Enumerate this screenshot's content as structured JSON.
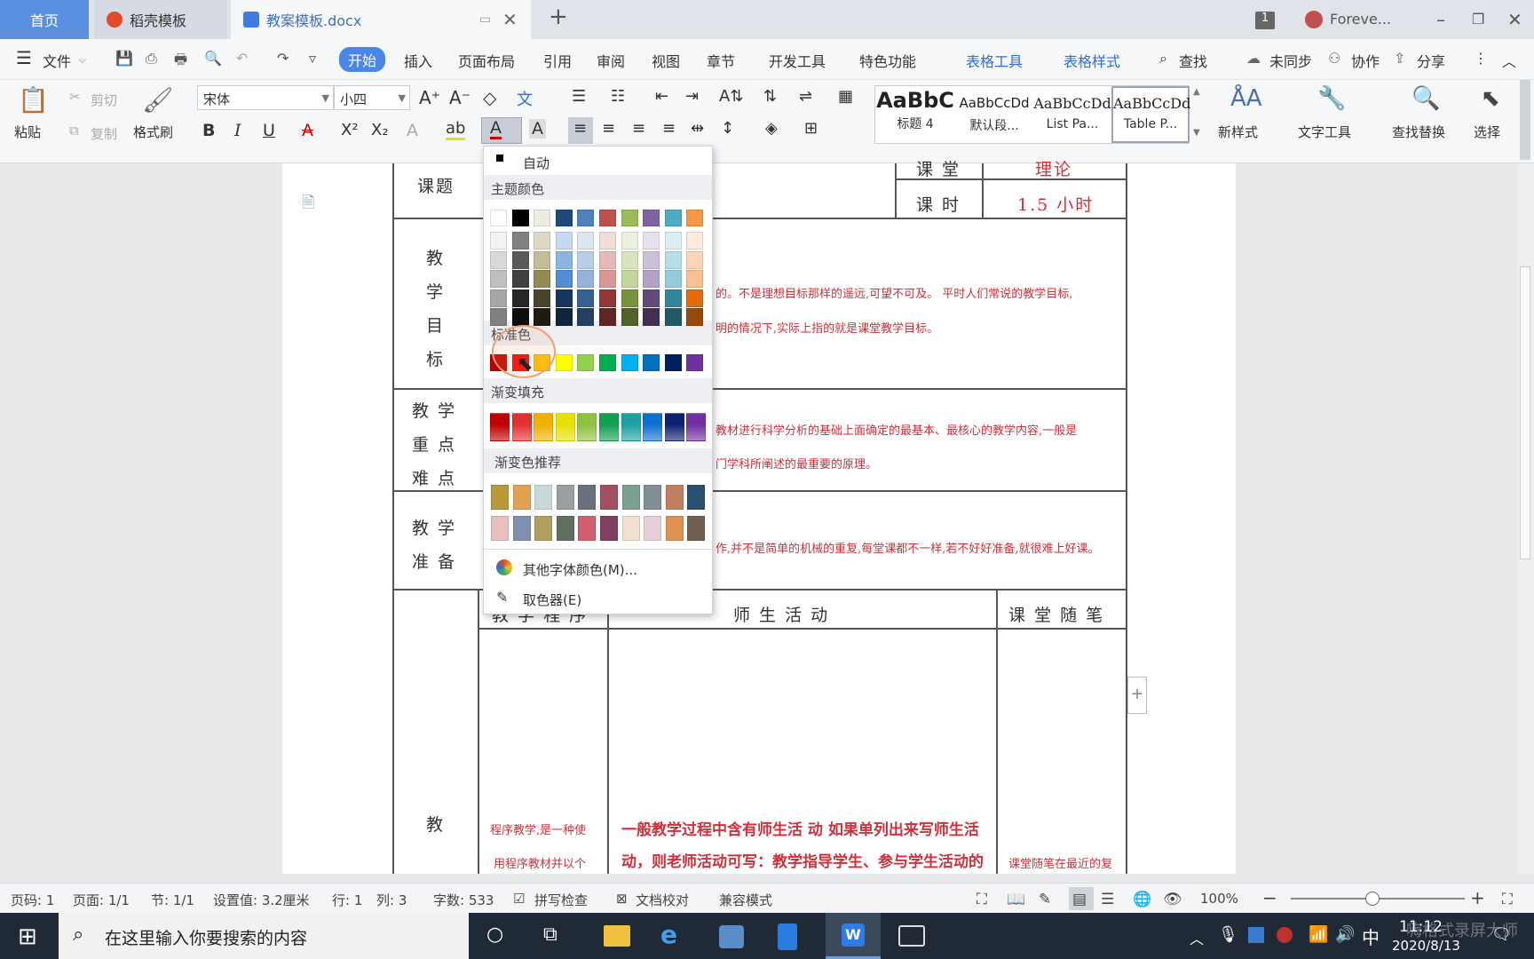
{
  "tabs": {
    "home": "首页",
    "template": "稻壳模板",
    "doc": "教案模板.docx",
    "user": "Foreve...",
    "page_badge": "1"
  },
  "menu": {
    "file": "文件",
    "items": [
      "开始",
      "插入",
      "页面布局",
      "引用",
      "审阅",
      "视图",
      "章节",
      "开发工具",
      "特色功能"
    ],
    "table_tools": "表格工具",
    "table_style": "表格样式",
    "find": "查找",
    "unsync": "未同步",
    "collab": "协作",
    "share": "分享"
  },
  "ribbon": {
    "paste": "粘贴",
    "cut": "剪切",
    "copy": "复制",
    "format_painter": "格式刷",
    "font": "宋体",
    "size": "小四",
    "styles": [
      {
        "big": "AaBbC",
        "name": "标题 4"
      },
      {
        "big": "AaBbCcDd",
        "name": "默认段..."
      },
      {
        "big": "AaBbCcDd",
        "name": "List Pa..."
      },
      {
        "big": "AaBbCcDd",
        "name": "Table P..."
      }
    ],
    "new_style": "新样式",
    "text_tools": "文字工具",
    "find_replace": "查找替换",
    "select": "选择"
  },
  "doc": {
    "ketizhu": "课题",
    "ketang": "课 堂",
    "lilun": "理论",
    "keshi": "课 时",
    "keshi_val": "1.5 小时",
    "c1": [
      "教",
      "学",
      "目",
      "标"
    ],
    "c2": [
      "教 学",
      "重 点",
      "难 点"
    ],
    "c3": [
      "教 学",
      "准 备"
    ],
    "c4": "教",
    "jiaoxue_chengxu": "教 学 程 序",
    "shisheng": "师 生 活 动",
    "suibi": "课 堂 随 笔",
    "red1": "的。不是理想目标那样的遥远,可望不可及。 平时人们常说的教学目标,",
    "red2": "明的情况下,实际上指的就是课堂教学目标。",
    "red3": "教材进行科学分析的基础上面确定的最基本、最核心的教学内容,一般是",
    "red4": "门学科所阐述的最重要的原理。",
    "red5": "作,并不是简单的机械的重复,每堂课都不一样,若不好好准备,就很难上好课。",
    "red6": "程序教学,是一种使",
    "red7": "用程序教材并以个",
    "red8": "一般教学过程中含有师生活 动 如果单列出来写师生活",
    "red9": "动，则老师活动可写：教学指导学生、参与学生活动的",
    "red10": "课堂随笔在最近的复"
  },
  "dropdown": {
    "auto": "自动",
    "theme": "主题颜色",
    "standard": "标准色",
    "gradient": "渐变填充",
    "gradient_rec": "渐变色推荐",
    "more": "其他字体颜色(M)...",
    "picker": "取色器(E)"
  },
  "theme_top": [
    "#ffffff",
    "#000000",
    "#eeece1",
    "#1f497d",
    "#4f81bd",
    "#c0504d",
    "#9bbb59",
    "#8064a2",
    "#4bacc6",
    "#f79646"
  ],
  "theme_cols": [
    [
      "#f2f2f2",
      "#d9d9d9",
      "#bfbfbf",
      "#a6a6a6",
      "#808080"
    ],
    [
      "#808080",
      "#595959",
      "#404040",
      "#262626",
      "#0d0d0d"
    ],
    [
      "#ddd9c4",
      "#c4bd97",
      "#948a54",
      "#4a452a",
      "#1e1c11"
    ],
    [
      "#c6d9f1",
      "#8db3e2",
      "#548dd4",
      "#17365d",
      "#0f243e"
    ],
    [
      "#dce6f2",
      "#b9cde5",
      "#95b3d7",
      "#366092",
      "#244061"
    ],
    [
      "#f2dcdb",
      "#e6b9b8",
      "#d99694",
      "#953735",
      "#632523"
    ],
    [
      "#ebf1de",
      "#d7e4bd",
      "#c3d69b",
      "#77933c",
      "#4f6228"
    ],
    [
      "#e6e0ec",
      "#ccc1da",
      "#b3a2c7",
      "#604a7b",
      "#403152"
    ],
    [
      "#dbeef4",
      "#b7dee8",
      "#93cddd",
      "#31859c",
      "#215968"
    ],
    [
      "#fdeada",
      "#fcd5b5",
      "#fac090",
      "#e46c0a",
      "#984807"
    ]
  ],
  "standard_colors": [
    "#c00000",
    "#ff0000",
    "#ffc000",
    "#ffff00",
    "#92d050",
    "#00b050",
    "#00b0f0",
    "#0070c0",
    "#002060",
    "#7030a0"
  ],
  "gradients": [
    "#c00000",
    "#e03030",
    "#f0b000",
    "#e8e000",
    "#90c040",
    "#10a050",
    "#20a0a0",
    "#1070d0",
    "#102070",
    "#7030a0"
  ],
  "grad_rec1": [
    "#b89a3a",
    "#e0a050",
    "#c8d8d8",
    "#9aa0a0",
    "#6a7080",
    "#a05060",
    "#7aa090",
    "#809090",
    "#c08060",
    "#2a5070"
  ],
  "grad_rec2": [
    "#e8c0c0",
    "#8090b0",
    "#b0a060",
    "#607060",
    "#d06070",
    "#804060",
    "#f0e0d0",
    "#e8d0d8",
    "#e09050",
    "#706050"
  ],
  "status": {
    "page": "页码: 1",
    "pages": "页面: 1/1",
    "section": "节: 1/1",
    "setting": "设置值: 3.2厘米",
    "row": "行: 1",
    "col": "列: 3",
    "words": "字数: 533",
    "spell": "拼写检查",
    "proof": "文档校对",
    "compat": "兼容模式",
    "zoom": "100%"
  },
  "taskbar": {
    "search": "在这里输入你要搜索的内容",
    "time": "11:12",
    "date": "2020/8/13",
    "ime": "中",
    "watermark": "嗨格式录屏大师"
  }
}
